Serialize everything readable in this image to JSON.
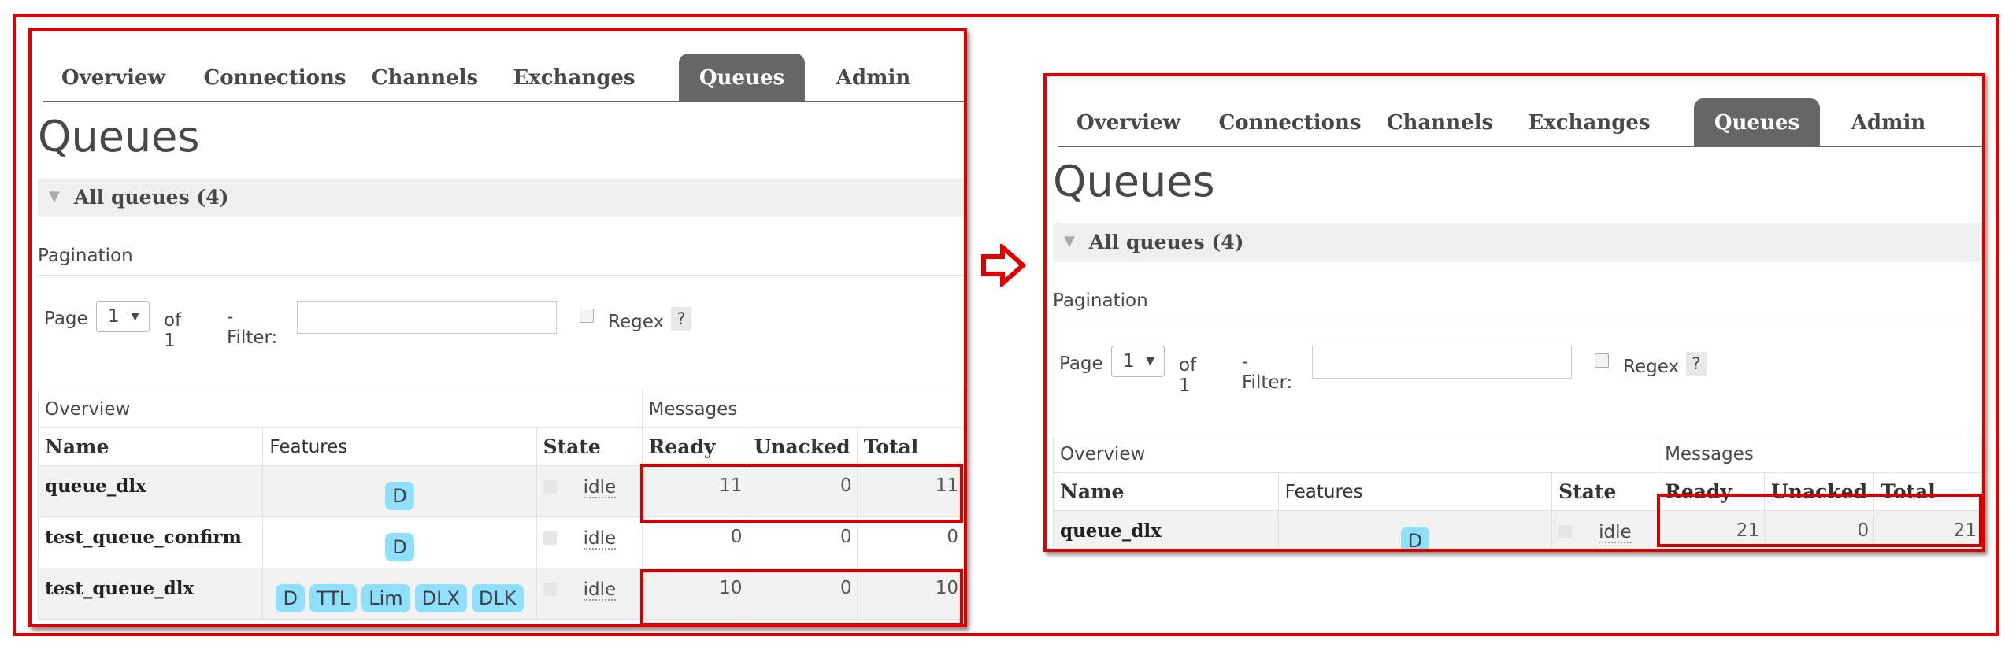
{
  "tabs": [
    "Overview",
    "Connections",
    "Channels",
    "Exchanges",
    "Queues",
    "Admin"
  ],
  "active_tab": "Queues",
  "page_title": "Queues",
  "section_label": "All queues (4)",
  "pagination": {
    "label": "Pagination",
    "page_word": "Page",
    "page_value": "1",
    "of_text": "of 1",
    "filter_label": "- Filter:",
    "filter_value": "",
    "regex_label": "Regex",
    "help": "?"
  },
  "table": {
    "group_headers": [
      "Overview",
      "Messages"
    ],
    "columns": [
      "Name",
      "Features",
      "State",
      "Ready",
      "Unacked",
      "Total"
    ]
  },
  "before": {
    "rows": [
      {
        "name": "queue_dlx",
        "features": [
          "D"
        ],
        "state": "idle",
        "ready": "11",
        "unacked": "0",
        "total": "11"
      },
      {
        "name": "test_queue_confirm",
        "features": [
          "D"
        ],
        "state": "idle",
        "ready": "0",
        "unacked": "0",
        "total": "0"
      },
      {
        "name": "test_queue_dlx",
        "features": [
          "D",
          "TTL",
          "Lim",
          "DLX",
          "DLK"
        ],
        "state": "idle",
        "ready": "10",
        "unacked": "0",
        "total": "10"
      }
    ]
  },
  "after": {
    "rows": [
      {
        "name": "queue_dlx",
        "features": [
          "D"
        ],
        "state": "idle",
        "ready": "21",
        "unacked": "0",
        "total": "21"
      }
    ]
  },
  "colors": {
    "highlight": "#e00000",
    "active_tab_bg": "#666666",
    "feature_badge": "#8fdfff"
  },
  "arrow": "right-arrow-icon"
}
